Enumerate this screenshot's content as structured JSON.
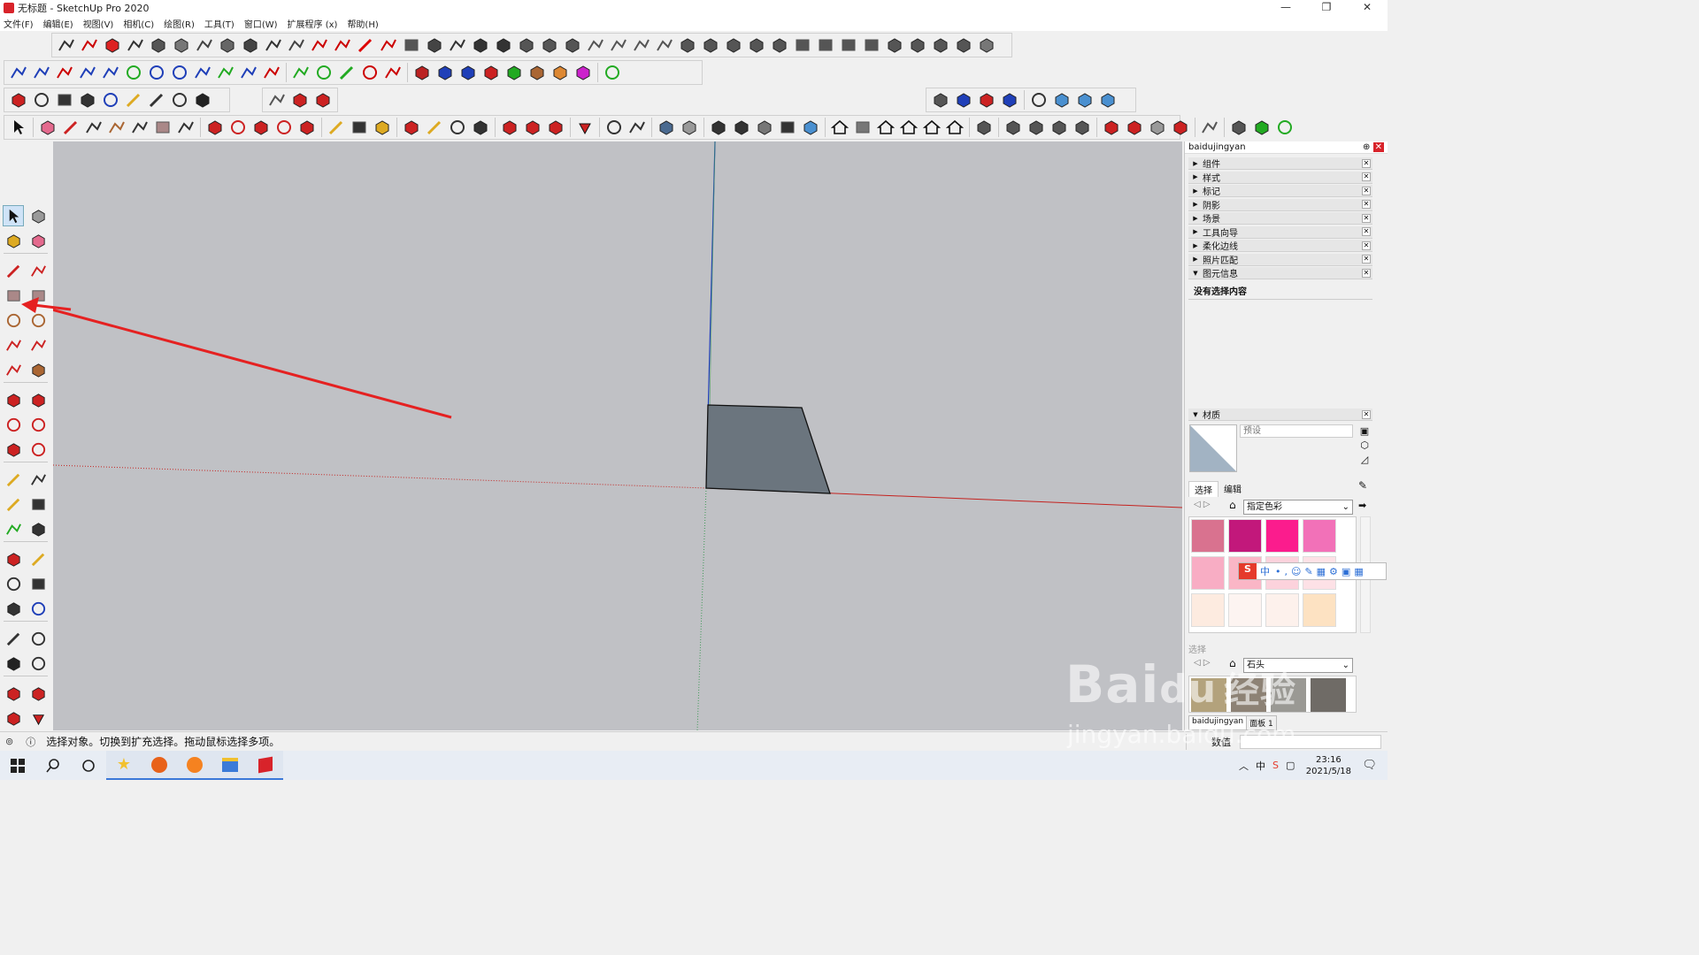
{
  "window": {
    "title": "无标题 - SketchUp Pro 2020",
    "min": "—",
    "max": "❐",
    "close": "✕"
  },
  "menu": [
    "文件(F)",
    "编辑(E)",
    "视图(V)",
    "相机(C)",
    "绘图(R)",
    "工具(T)",
    "窗口(W)",
    "扩展程序 (x)",
    "帮助(H)"
  ],
  "tray": {
    "title": "baidujingyan",
    "sections": [
      "组件",
      "样式",
      "标记",
      "阴影",
      "场景",
      "工具向导",
      "柔化边线",
      "照片匹配",
      "图元信息"
    ],
    "entity_info": "没有选择内容",
    "materials": {
      "header": "材质",
      "name_placeholder": "预设",
      "tabs": [
        "选择",
        "编辑"
      ],
      "library": "指定色彩",
      "library2": "石头",
      "secondary_label": "选择",
      "swatch_colors": [
        "#d9728f",
        "#c2187b",
        "#fb1c8d",
        "#f271b8",
        "#f8adc4",
        "#fab6c6",
        "#fcd2dc",
        "#fde1e6",
        "#fdebe0",
        "#fdf4f1",
        "#fdf1ec",
        "#fde2c2"
      ],
      "stone_colors": [
        "#b3a27c",
        "#8d8275",
        "#9a9994",
        "#6f6b66"
      ]
    },
    "bottom_tabs": [
      "baidujingyan",
      "面板 1"
    ],
    "value_label": "数值"
  },
  "status": {
    "text": "选择对象。切换到扩充选择。拖动鼠标选择多项。"
  },
  "taskbar": {
    "time": "23:16",
    "date": "2021/5/18"
  },
  "ime": {
    "lang": "中"
  },
  "watermark": {
    "brand": "Bai",
    "brand2": "du",
    "cn": "经验",
    "url": "jingyan.baidu.com"
  }
}
